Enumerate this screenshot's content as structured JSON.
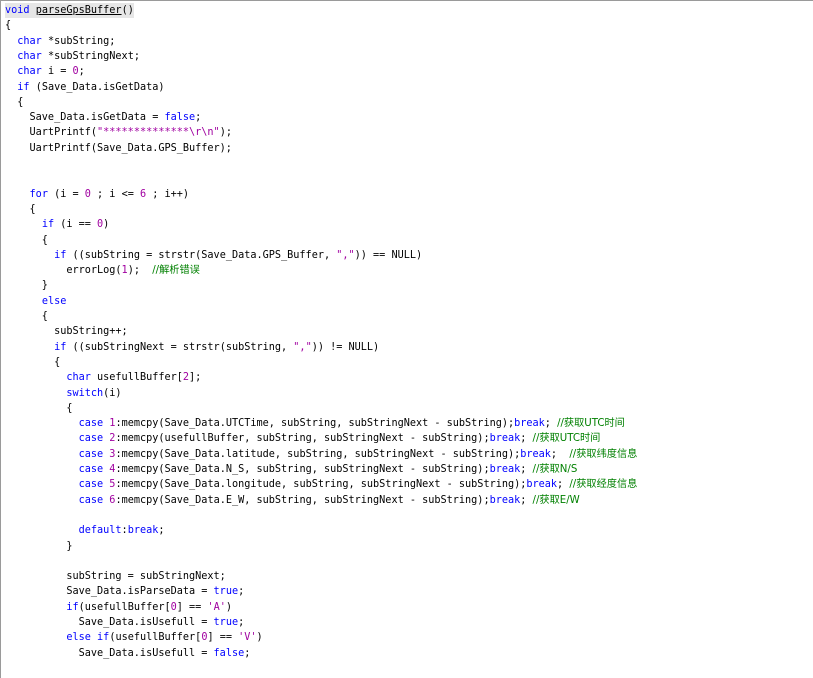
{
  "code": {
    "lines": [
      [
        [
          "k",
          "void"
        ],
        [
          "p",
          " "
        ],
        [
          "f",
          "parseGpsBuffer"
        ],
        [
          "p",
          "()"
        ]
      ],
      [
        [
          "p",
          "{"
        ]
      ],
      [
        [
          "p",
          "  "
        ],
        [
          "k",
          "char"
        ],
        [
          "p",
          " *subString;"
        ]
      ],
      [
        [
          "p",
          "  "
        ],
        [
          "k",
          "char"
        ],
        [
          "p",
          " *subStringNext;"
        ]
      ],
      [
        [
          "p",
          "  "
        ],
        [
          "k",
          "char"
        ],
        [
          "p",
          " i = "
        ],
        [
          "n",
          "0"
        ],
        [
          "p",
          ";"
        ]
      ],
      [
        [
          "p",
          "  "
        ],
        [
          "k",
          "if"
        ],
        [
          "p",
          " (Save_Data.isGetData)"
        ]
      ],
      [
        [
          "p",
          "  {"
        ]
      ],
      [
        [
          "p",
          "    Save_Data.isGetData = "
        ],
        [
          "k",
          "false"
        ],
        [
          "p",
          ";"
        ]
      ],
      [
        [
          "p",
          "    UartPrintf("
        ],
        [
          "s",
          "\"**************\\r\\n\""
        ],
        [
          "p",
          ");"
        ]
      ],
      [
        [
          "p",
          "    UartPrintf(Save_Data.GPS_Buffer);"
        ]
      ],
      [
        [
          "p",
          ""
        ]
      ],
      [
        [
          "p",
          ""
        ]
      ],
      [
        [
          "p",
          "    "
        ],
        [
          "k",
          "for"
        ],
        [
          "p",
          " (i = "
        ],
        [
          "n",
          "0"
        ],
        [
          "p",
          " ; i <= "
        ],
        [
          "n",
          "6"
        ],
        [
          "p",
          " ; i++)"
        ]
      ],
      [
        [
          "p",
          "    {"
        ]
      ],
      [
        [
          "p",
          "      "
        ],
        [
          "k",
          "if"
        ],
        [
          "p",
          " (i == "
        ],
        [
          "n",
          "0"
        ],
        [
          "p",
          ")"
        ]
      ],
      [
        [
          "p",
          "      {"
        ]
      ],
      [
        [
          "p",
          "        "
        ],
        [
          "k",
          "if"
        ],
        [
          "p",
          " ((subString = strstr(Save_Data.GPS_Buffer, "
        ],
        [
          "s",
          "\",\""
        ],
        [
          "p",
          ")) == NULL)"
        ]
      ],
      [
        [
          "p",
          "          errorLog("
        ],
        [
          "n",
          "1"
        ],
        [
          "p",
          ");  "
        ],
        [
          "c",
          "//解析错误"
        ]
      ],
      [
        [
          "p",
          "      }"
        ]
      ],
      [
        [
          "p",
          "      "
        ],
        [
          "k",
          "else"
        ]
      ],
      [
        [
          "p",
          "      {"
        ]
      ],
      [
        [
          "p",
          "        subString++;"
        ]
      ],
      [
        [
          "p",
          "        "
        ],
        [
          "k",
          "if"
        ],
        [
          "p",
          " ((subStringNext = strstr(subString, "
        ],
        [
          "s",
          "\",\""
        ],
        [
          "p",
          ")) != NULL)"
        ]
      ],
      [
        [
          "p",
          "        {"
        ]
      ],
      [
        [
          "p",
          "          "
        ],
        [
          "k",
          "char"
        ],
        [
          "p",
          " usefullBuffer["
        ],
        [
          "n",
          "2"
        ],
        [
          "p",
          "];"
        ]
      ],
      [
        [
          "p",
          "          "
        ],
        [
          "k",
          "switch"
        ],
        [
          "p",
          "(i)"
        ]
      ],
      [
        [
          "p",
          "          {"
        ]
      ],
      [
        [
          "p",
          "            "
        ],
        [
          "k",
          "case"
        ],
        [
          "p",
          " "
        ],
        [
          "n",
          "1"
        ],
        [
          "p",
          ":memcpy(Save_Data.UTCTime, subString, subStringNext - subString);"
        ],
        [
          "k",
          "break"
        ],
        [
          "p",
          "; "
        ],
        [
          "c",
          "//获取UTC时间"
        ]
      ],
      [
        [
          "p",
          "            "
        ],
        [
          "k",
          "case"
        ],
        [
          "p",
          " "
        ],
        [
          "n",
          "2"
        ],
        [
          "p",
          ":memcpy(usefullBuffer, subString, subStringNext - subString);"
        ],
        [
          "k",
          "break"
        ],
        [
          "p",
          "; "
        ],
        [
          "c",
          "//获取UTC时间"
        ]
      ],
      [
        [
          "p",
          "            "
        ],
        [
          "k",
          "case"
        ],
        [
          "p",
          " "
        ],
        [
          "n",
          "3"
        ],
        [
          "p",
          ":memcpy(Save_Data.latitude, subString, subStringNext - subString);"
        ],
        [
          "k",
          "break"
        ],
        [
          "p",
          ";  "
        ],
        [
          "c",
          "//获取纬度信息"
        ]
      ],
      [
        [
          "p",
          "            "
        ],
        [
          "k",
          "case"
        ],
        [
          "p",
          " "
        ],
        [
          "n",
          "4"
        ],
        [
          "p",
          ":memcpy(Save_Data.N_S, subString, subStringNext - subString);"
        ],
        [
          "k",
          "break"
        ],
        [
          "p",
          "; "
        ],
        [
          "c",
          "//获取N/S"
        ]
      ],
      [
        [
          "p",
          "            "
        ],
        [
          "k",
          "case"
        ],
        [
          "p",
          " "
        ],
        [
          "n",
          "5"
        ],
        [
          "p",
          ":memcpy(Save_Data.longitude, subString, subStringNext - subString);"
        ],
        [
          "k",
          "break"
        ],
        [
          "p",
          "; "
        ],
        [
          "c",
          "//获取经度信息"
        ]
      ],
      [
        [
          "p",
          "            "
        ],
        [
          "k",
          "case"
        ],
        [
          "p",
          " "
        ],
        [
          "n",
          "6"
        ],
        [
          "p",
          ":memcpy(Save_Data.E_W, subString, subStringNext - subString);"
        ],
        [
          "k",
          "break"
        ],
        [
          "p",
          "; "
        ],
        [
          "c",
          "//获取E/W"
        ]
      ],
      [
        [
          "p",
          ""
        ]
      ],
      [
        [
          "p",
          "            "
        ],
        [
          "k",
          "default"
        ],
        [
          "p",
          ":"
        ],
        [
          "k",
          "break"
        ],
        [
          "p",
          ";"
        ]
      ],
      [
        [
          "p",
          "          }"
        ]
      ],
      [
        [
          "p",
          ""
        ]
      ],
      [
        [
          "p",
          "          subString = subStringNext;"
        ]
      ],
      [
        [
          "p",
          "          Save_Data.isParseData = "
        ],
        [
          "k",
          "true"
        ],
        [
          "p",
          ";"
        ]
      ],
      [
        [
          "p",
          "          "
        ],
        [
          "k",
          "if"
        ],
        [
          "p",
          "(usefullBuffer["
        ],
        [
          "n",
          "0"
        ],
        [
          "p",
          "] == "
        ],
        [
          "s",
          "'A'"
        ],
        [
          "p",
          ")"
        ]
      ],
      [
        [
          "p",
          "            Save_Data.isUsefull = "
        ],
        [
          "k",
          "true"
        ],
        [
          "p",
          ";"
        ]
      ],
      [
        [
          "p",
          "          "
        ],
        [
          "k",
          "else"
        ],
        [
          "p",
          " "
        ],
        [
          "k",
          "if"
        ],
        [
          "p",
          "(usefullBuffer["
        ],
        [
          "n",
          "0"
        ],
        [
          "p",
          "] == "
        ],
        [
          "s",
          "'V'"
        ],
        [
          "p",
          ")"
        ]
      ],
      [
        [
          "p",
          "            Save_Data.isUsefull = "
        ],
        [
          "k",
          "false"
        ],
        [
          "p",
          ";"
        ]
      ],
      [
        [
          "p",
          ""
        ]
      ],
      [
        [
          "p",
          "        }"
        ]
      ]
    ]
  },
  "colors": {
    "keyword": "#0000ff",
    "string": "#a000a0",
    "number": "#a000a0",
    "comment": "#008000",
    "text": "#000000",
    "background": "#ffffff"
  }
}
